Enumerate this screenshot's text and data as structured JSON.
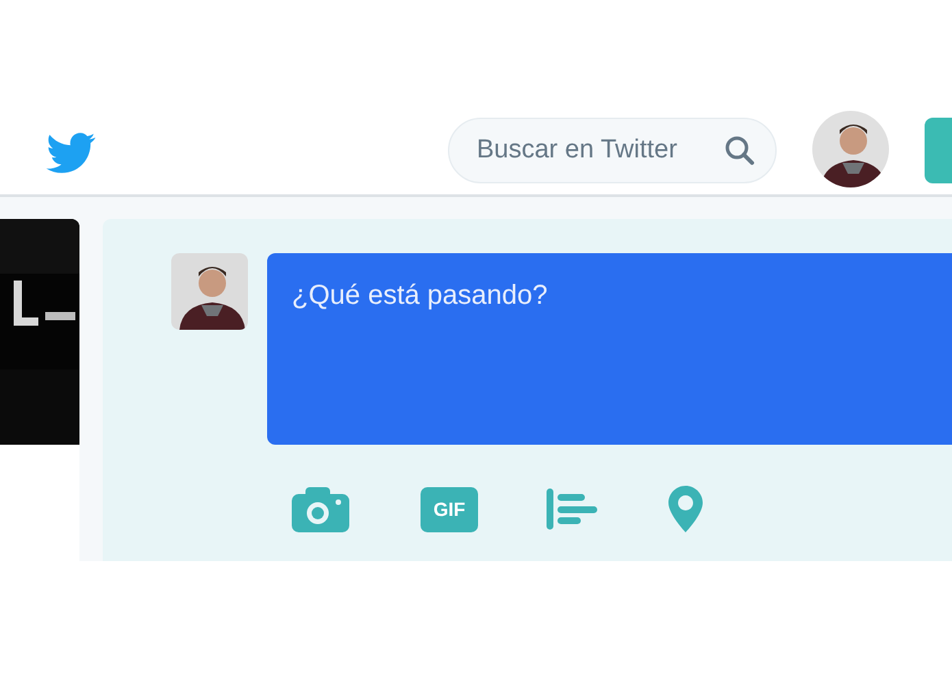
{
  "header": {
    "search": {
      "placeholder": "Buscar en Twitter"
    }
  },
  "compose": {
    "placeholder": "¿Qué está pasando?",
    "tools": [
      {
        "kind": "camera"
      },
      {
        "kind": "gif",
        "label": "GIF"
      },
      {
        "kind": "poll"
      },
      {
        "kind": "location"
      }
    ]
  }
}
